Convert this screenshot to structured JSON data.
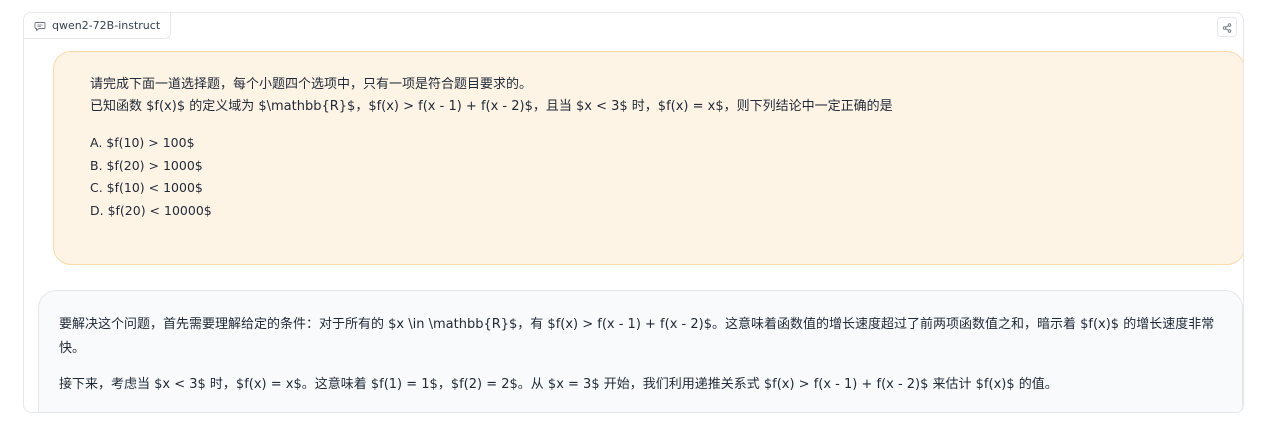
{
  "header": {
    "model_name": "qwen2-72B-instruct",
    "model_icon": "chat-bubble-icon",
    "share_icon": "share-icon"
  },
  "user_message": {
    "line1": "请完成下面一道选择题，每个小题四个选项中，只有一项是符合题目要求的。",
    "line2": "已知函数 $f(x)$ 的定义域为 $\\mathbb{R}$，$f(x) > f(x - 1) + f(x - 2)$，且当 $x < 3$ 时，$f(x) = x$，则下列结论中一定正确的是",
    "options": [
      "A. $f(10) > 100$",
      "B. $f(20) > 1000$",
      "C. $f(10) < 1000$",
      "D. $f(20) < 10000$"
    ]
  },
  "bot_message": {
    "paragraph1": "要解决这个问题，首先需要理解给定的条件：对于所有的 $x \\in \\mathbb{R}$，有 $f(x) > f(x - 1) + f(x - 2)$。这意味着函数值的增长速度超过了前两项函数值之和，暗示着 $f(x)$ 的增长速度非常快。",
    "paragraph2": "接下来，考虑当 $x < 3$ 时，$f(x) = x$。这意味着 $f(1) = 1$，$f(2) = 2$。从 $x = 3$ 开始，我们利用递推关系式 $f(x) > f(x - 1) + f(x - 2)$ 来估计 $f(x)$ 的值。"
  },
  "colors": {
    "user_bg": "#fef4e6",
    "user_border": "#fbd9a8",
    "bot_bg": "#f9fafb",
    "border": "#e5e7eb"
  }
}
